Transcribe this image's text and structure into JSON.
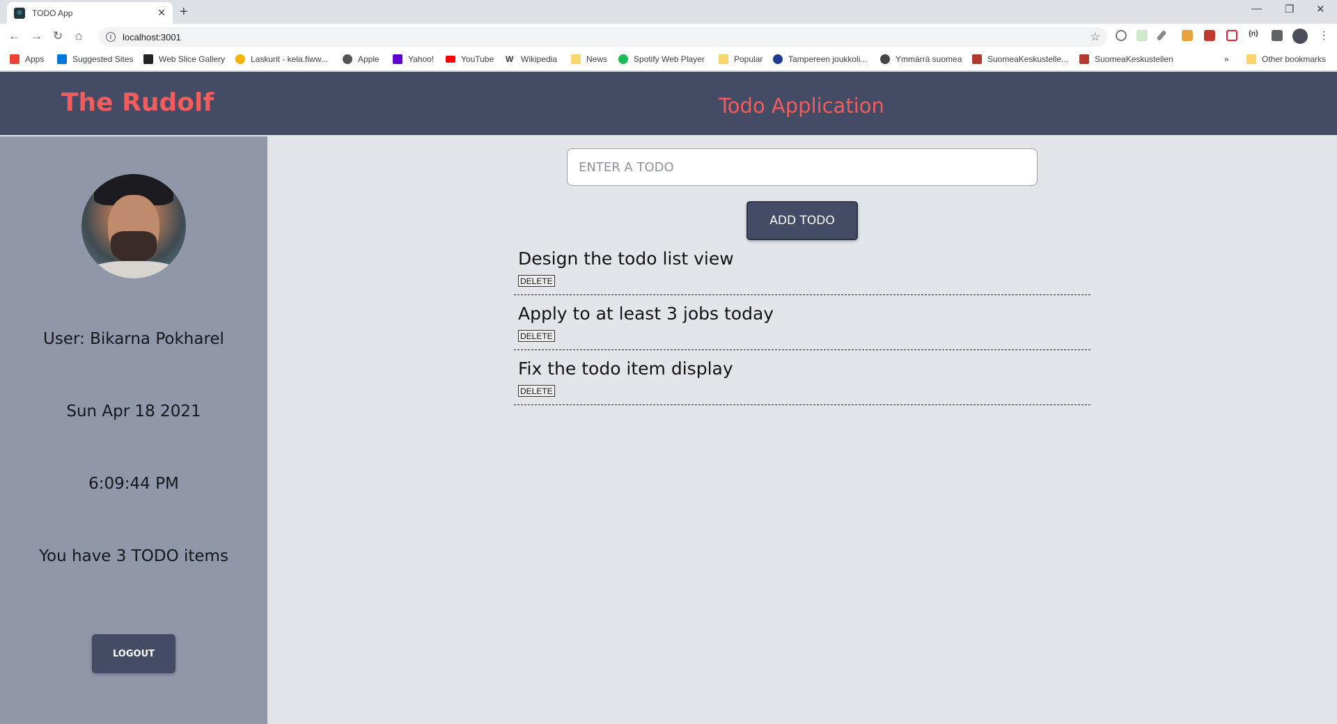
{
  "browser": {
    "tab_title": "TODO App",
    "url": "localhost:3001",
    "bookmarks": [
      {
        "label": "Apps",
        "color": "#ea4335"
      },
      {
        "label": "Suggested Sites",
        "color": "#0078d7"
      },
      {
        "label": "Web Slice Gallery",
        "color": "#222222"
      },
      {
        "label": "Laskurit - kela.fiww...",
        "color": "#f4b400"
      },
      {
        "label": "Apple",
        "color": "#555555"
      },
      {
        "label": "Yahoo!",
        "color": "#6001d2"
      },
      {
        "label": "YouTube",
        "color": "#ff0000"
      },
      {
        "label": "Wikipedia",
        "color": "#333333"
      },
      {
        "label": "News",
        "color": "#f9d56e"
      },
      {
        "label": "Spotify Web Player",
        "color": "#1db954"
      },
      {
        "label": "Popular",
        "color": "#f9d56e"
      },
      {
        "label": "Tampereen joukkoli...",
        "color": "#1f3a93"
      },
      {
        "label": "Ymmärrä suomea",
        "color": "#444444"
      },
      {
        "label": "SuomeaKeskustelle...",
        "color": "#b03a2e"
      },
      {
        "label": "SuomeaKeskustellen",
        "color": "#b03a2e"
      }
    ],
    "other_bookmarks": "Other bookmarks"
  },
  "header": {
    "brand": "The Rudolf",
    "title": "Todo Application"
  },
  "sidebar": {
    "user": "User: Bikarna Pokharel",
    "date": "Sun Apr 18 2021",
    "time": "6:09:44 PM",
    "count_text": "You have 3 TODO items",
    "logout_label": "LOGOUT"
  },
  "main": {
    "input_placeholder": "ENTER A TODO",
    "input_value": "",
    "add_label": "ADD TODO",
    "todos": [
      {
        "text": "Design the todo list view",
        "delete_label": "DELETE"
      },
      {
        "text": "Apply to at least 3 jobs today",
        "delete_label": "DELETE"
      },
      {
        "text": "Fix the todo item display",
        "delete_label": "DELETE"
      }
    ]
  },
  "colors": {
    "header_bg": "#444c65",
    "accent": "#f25c5c",
    "sidebar_bg": "#9097a9",
    "main_bg": "#e2e6ea"
  }
}
